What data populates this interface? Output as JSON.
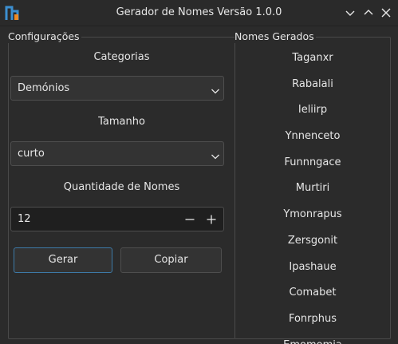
{
  "window": {
    "title": "Gerador de Nomes Versão 1.0.0",
    "icon": "app-logo-icon",
    "controls": [
      "minimize-icon",
      "maximize-icon",
      "close-icon"
    ]
  },
  "config": {
    "group_title": "Configurações",
    "categories_label": "Categorias",
    "category_value": "Demónios",
    "size_label": "Tamanho",
    "size_value": "curto",
    "quantity_label": "Quantidade de Nomes",
    "quantity_value": "12",
    "generate_label": "Gerar",
    "copy_label": "Copiar"
  },
  "output": {
    "group_title": "Nomes Gerados",
    "names": [
      "Taganxr",
      "Rabalali",
      "Ieliirp",
      "Ynnenceto",
      "Funnngace",
      "Murtiri",
      "Ymonrapus",
      "Zersgonit",
      "Ipashaue",
      "Comabet",
      "Fonrphus",
      "Emomomia"
    ]
  },
  "colors": {
    "background": "#2b2b2b",
    "border": "#4a4a4a",
    "focus_border": "#3d7aa8",
    "icon_accent": "#3c8fd0",
    "icon_secondary": "#f08a24"
  }
}
